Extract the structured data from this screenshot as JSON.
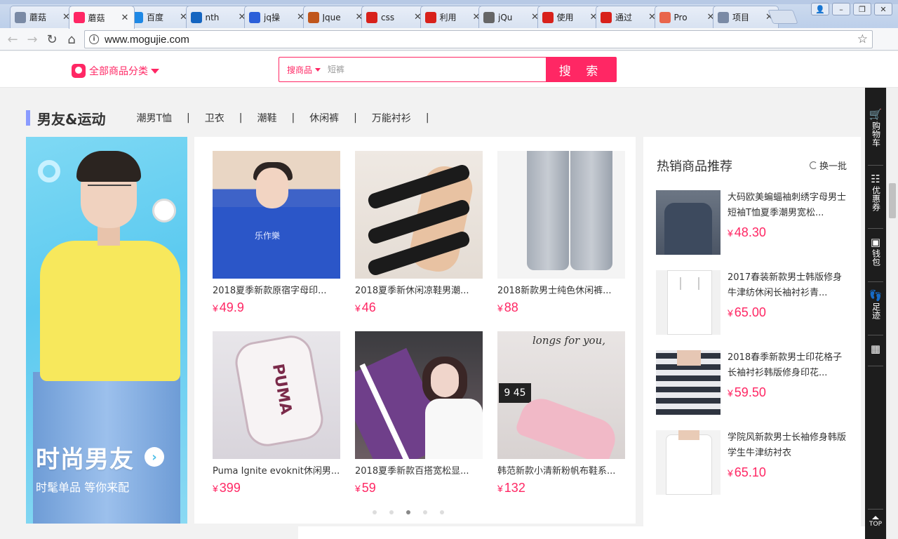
{
  "browser": {
    "tabs": [
      {
        "title": "蘑菇",
        "icon": "doc-icon",
        "color": "#7a8aa5",
        "active": false
      },
      {
        "title": "蘑菇",
        "icon": "mogujie-icon",
        "color": "#ff2764",
        "active": true
      },
      {
        "title": "百度",
        "icon": "translate-icon",
        "color": "#1e88e5",
        "active": false
      },
      {
        "title": "nth",
        "icon": "w3c-icon",
        "color": "#1565c0",
        "active": false
      },
      {
        "title": "jq操",
        "icon": "baidu-paw-icon",
        "color": "#2b5fd9",
        "active": false
      },
      {
        "title": "Jque",
        "icon": "b-icon",
        "color": "#c0561c",
        "active": false
      },
      {
        "title": "css",
        "icon": "csdn-icon",
        "color": "#d8211b",
        "active": false
      },
      {
        "title": "利用",
        "icon": "csdn-icon",
        "color": "#d8211b",
        "active": false
      },
      {
        "title": "jQu",
        "icon": "paw-icon",
        "color": "#666666",
        "active": false
      },
      {
        "title": "使用",
        "icon": "csdn-icon",
        "color": "#d8211b",
        "active": false
      },
      {
        "title": "通过",
        "icon": "csdn-icon",
        "color": "#d8211b",
        "active": false
      },
      {
        "title": "Pro",
        "icon": "jianshu-icon",
        "color": "#e9654b",
        "active": false
      },
      {
        "title": "项目",
        "icon": "doc-icon",
        "color": "#7a8aa5",
        "active": false
      }
    ],
    "url": "www.mogujie.com"
  },
  "header": {
    "category_label": "全部商品分类",
    "search_scope": "搜商品",
    "search_placeholder": "短裤",
    "search_button": "搜 索"
  },
  "section": {
    "title": "男友&运动",
    "links": [
      "潮男T恤",
      "卫衣",
      "潮鞋",
      "休闲裤",
      "万能衬衫"
    ]
  },
  "banner": {
    "title": "时尚男友",
    "subtitle": "时髦单品 等你来配"
  },
  "products": [
    {
      "name": "2018夏季新款原宿字母印...",
      "price": "49.9"
    },
    {
      "name": "2018夏季新休闲凉鞋男潮...",
      "price": "46"
    },
    {
      "name": "2018新款男士纯色休闲裤...",
      "price": "88"
    },
    {
      "name": "Puma Ignite evoknit休闲男...",
      "price": "399"
    },
    {
      "name": "2018夏季新款百搭宽松显...",
      "price": "59"
    },
    {
      "name": "韩范新款小清新粉帆布鞋系...",
      "price": "132"
    }
  ],
  "product_images": {
    "p1_text": "乐作樂",
    "p4_brand": "PUMA",
    "p6_script": "longs for you,",
    "p6_clock": "9 45"
  },
  "carousel": {
    "count": 5,
    "active_index": 2
  },
  "currency": "¥",
  "hot": {
    "title": "热销商品推荐",
    "refresh": "换一批",
    "items": [
      {
        "name": "大码欧美蝙蝠袖刺绣字母男士短袖T恤夏季潮男宽松...",
        "price": "48.30"
      },
      {
        "name": "2017春装新款男士韩版修身牛津纺休闲长袖衬衫青...",
        "price": "65.00"
      },
      {
        "name": "2018春季新款男士印花格子长袖衬衫韩版修身印花...",
        "price": "59.50"
      },
      {
        "name": "学院风新款男士长袖修身韩版学生牛津纺衬衣",
        "price": "65.10"
      }
    ]
  },
  "sidebar": {
    "items": [
      {
        "label": "购物车",
        "icon": "cart-icon"
      },
      {
        "label": "优惠券",
        "icon": "coupon-icon"
      },
      {
        "label": "钱包",
        "icon": "wallet-icon"
      },
      {
        "label": "足迹",
        "icon": "footprint-icon"
      },
      {
        "label": "",
        "icon": "qrcode-icon"
      }
    ],
    "top_label": "TOP"
  },
  "colors": {
    "brand": "#ff2764",
    "section_bar": "#8a9bff",
    "sidebar": "#1d1d1d"
  }
}
